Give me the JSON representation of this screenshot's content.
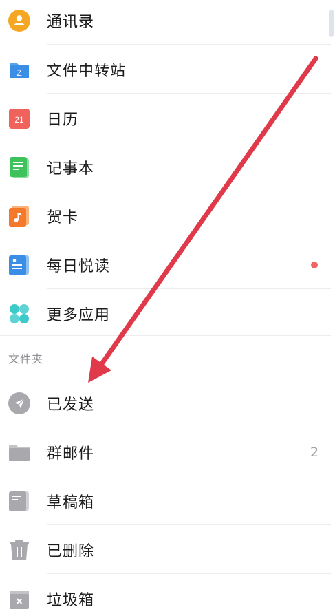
{
  "apps": [
    {
      "label": "通讯录",
      "icon": "contacts-icon"
    },
    {
      "label": "文件中转站",
      "icon": "file-transfer-icon",
      "icon_text": "Z"
    },
    {
      "label": "日历",
      "icon": "calendar-icon",
      "icon_text": "21"
    },
    {
      "label": "记事本",
      "icon": "notepad-icon"
    },
    {
      "label": "贺卡",
      "icon": "greeting-card-icon"
    },
    {
      "label": "每日悦读",
      "icon": "daily-reading-icon",
      "has_dot": true
    },
    {
      "label": "更多应用",
      "icon": "more-apps-icon"
    }
  ],
  "folders_header": "文件夹",
  "folders": [
    {
      "label": "已发送",
      "icon": "sent-icon"
    },
    {
      "label": "群邮件",
      "icon": "group-mail-folder-icon",
      "count": "2"
    },
    {
      "label": "草稿箱",
      "icon": "drafts-icon"
    },
    {
      "label": "已删除",
      "icon": "trash-icon"
    },
    {
      "label": "垃圾箱",
      "icon": "spam-icon"
    }
  ],
  "colors": {
    "contacts": "#f5a623",
    "file_transfer": "#3a8ee6",
    "calendar": "#f0625c",
    "notepad": "#3ec25b",
    "greeting_card": "#f5792a",
    "daily_reading": "#3a8ee6",
    "more_apps": "#3ccacb",
    "folder_gray": "#b0b0b5",
    "badge_dot": "#f06464",
    "arrow": "#e03a4a"
  }
}
